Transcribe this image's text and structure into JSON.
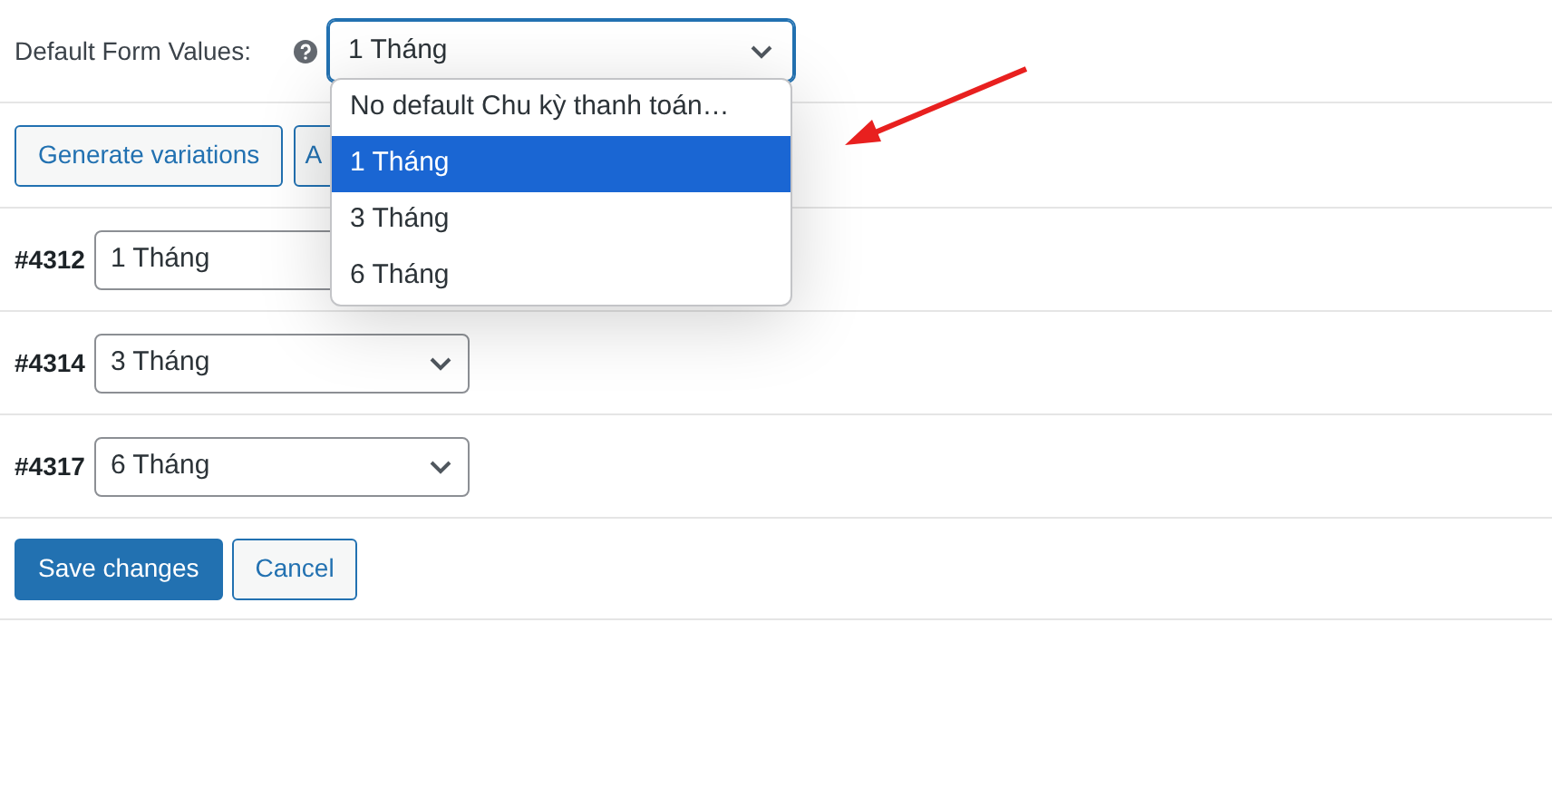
{
  "default_form_values": {
    "label": "Default Form Values:",
    "value": "1 Tháng",
    "dropdown": [
      {
        "label": "No default Chu kỳ thanh toán…",
        "selected": false
      },
      {
        "label": "1 Tháng",
        "selected": true
      },
      {
        "label": "3 Tháng",
        "selected": false
      },
      {
        "label": "6 Tháng",
        "selected": false
      }
    ]
  },
  "actions": [
    "Generate variations",
    "A"
  ],
  "variations": [
    {
      "id": "#4312",
      "value": "1 Tháng"
    },
    {
      "id": "#4314",
      "value": "3 Tháng"
    },
    {
      "id": "#4317",
      "value": "6 Tháng"
    }
  ],
  "buttons": [
    {
      "label": "Save changes",
      "kind": "primary"
    },
    {
      "label": "Cancel",
      "kind": "secondary"
    }
  ]
}
